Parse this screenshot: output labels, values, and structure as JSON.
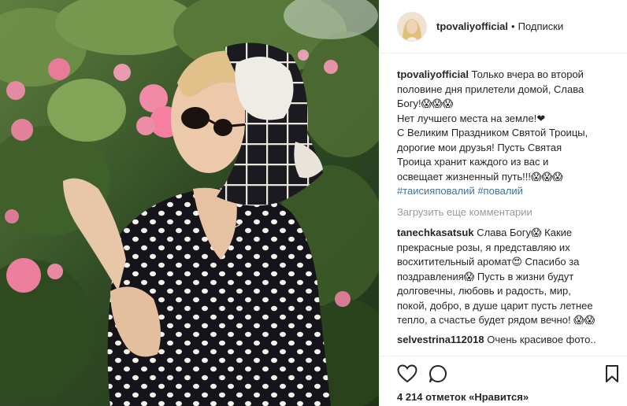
{
  "post": {
    "username": "tpovaliyofficial",
    "separator": "•",
    "follow_label": "Подписки",
    "caption_lines": [
      "Только вчера во второй",
      "половине дня прилетели домой, Слава",
      "Богу!😱😱😱",
      "Нет лучшего места на земле!❤",
      "С Великим Праздником Святой Троицы,",
      "дорогие мои друзья! Пусть Святая",
      "Троица хранит каждого из вас и",
      "освещает жизненный путь!!!😱😱😱"
    ],
    "hashtags": [
      "#таисияповалий",
      "#повалий"
    ],
    "load_more_label": "Загрузить еще комментарии",
    "comments": [
      {
        "user": "tanechkasatsuk",
        "text_lines": [
          "Слава Богу😱 Какие",
          "прекрасные розы, я представляю их",
          "восхитительный аромат😍 Спасибо за",
          "поздравления😱 Пусть в жизни будут",
          "долговечны, любовь и радость, мир,",
          "покой, добро, в душе царит пусть летнее",
          "тепло, а счастье будет рядом вечно! 😱😱"
        ]
      },
      {
        "user": "selvestrina112018",
        "text_lines": [
          "Очень красивое фото.."
        ]
      }
    ],
    "likes_count": "4 214",
    "likes_suffix": "отметок «Нравится»"
  },
  "icons": {
    "like": "heart-outline-icon",
    "comment": "speech-bubble-icon",
    "save": "bookmark-icon"
  }
}
